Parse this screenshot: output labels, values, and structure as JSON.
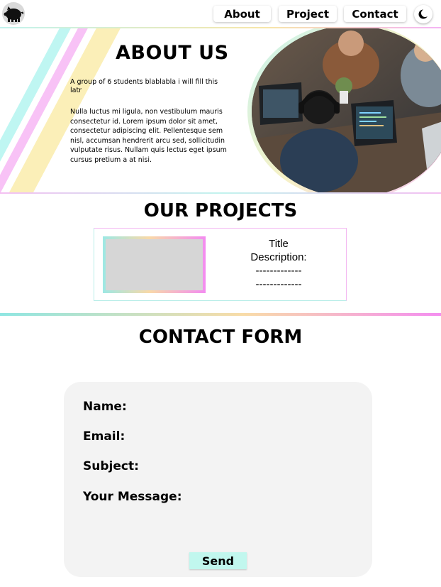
{
  "nav": {
    "logo_icon": "pig-icon",
    "about_label": "About",
    "project_label": "Project",
    "contact_label": "Contact",
    "dark_mode_icon": "moon-icon"
  },
  "about": {
    "title": "ABOUT US",
    "intro": "A group of 6 students blablabla i will fill this latr",
    "body": "Nulla luctus mi ligula, non vestibulum mauris consectetur id. Lorem ipsum dolor sit amet, consectetur adipiscing elit. Pellentesque sem nisl, accumsan hendrerit arcu sed, sollicitudin vulputate risus. Nullam quis lectus eget ipsum cursus pretium a at nisi."
  },
  "projects": {
    "title": "OUR PROJECTS",
    "items": [
      {
        "title": "Title",
        "description_label": "Description:",
        "line1": "-------------",
        "line2": "-------------"
      }
    ]
  },
  "contact": {
    "title": "CONTACT FORM",
    "name_label": "Name:",
    "email_label": "Email:",
    "subject_label": "Subject:",
    "message_label": "Your Message:",
    "send_label": "Send"
  },
  "colors": {
    "accent_teal": "#c1f7ee",
    "accent_pink": "#f48ef0",
    "accent_yellow": "#fbefb8",
    "form_bg": "#f3f3f3"
  }
}
